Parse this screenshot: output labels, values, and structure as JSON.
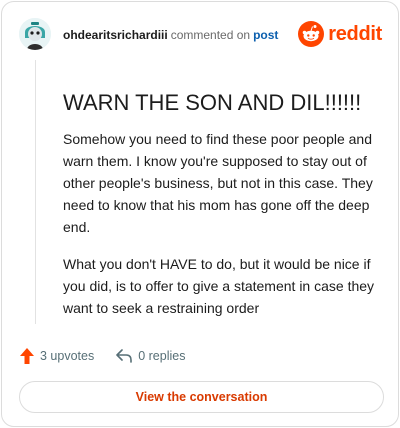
{
  "header": {
    "username": "ohdearitsrichardiii",
    "commented_on": "commented on",
    "post_link": "post",
    "logo_text": "reddit"
  },
  "comment": {
    "title": "WARN THE SON AND DIL!!!!!!",
    "paragraphs": [
      "Somehow you need to find these poor people and warn them. I know you're supposed to stay out of other people's business, but not in this case. They need to know that his mom has gone off the deep end.",
      "What you don't HAVE to do, but it would be nice if you did, is to offer to give a statement in case they want to seek a restraining order"
    ]
  },
  "actions": {
    "upvotes_label": "3 upvotes",
    "replies_label": "0 replies"
  },
  "cta": {
    "label": "View the conversation"
  },
  "icons": {
    "avatar": "avatar-icon",
    "logo": "reddit-logo-icon",
    "upvote": "upvote-arrow-icon",
    "reply": "reply-arrow-icon"
  },
  "colors": {
    "brand": "#ff4500",
    "link": "#0b5fae",
    "cta_text": "#d93a00",
    "muted": "#576f76"
  }
}
